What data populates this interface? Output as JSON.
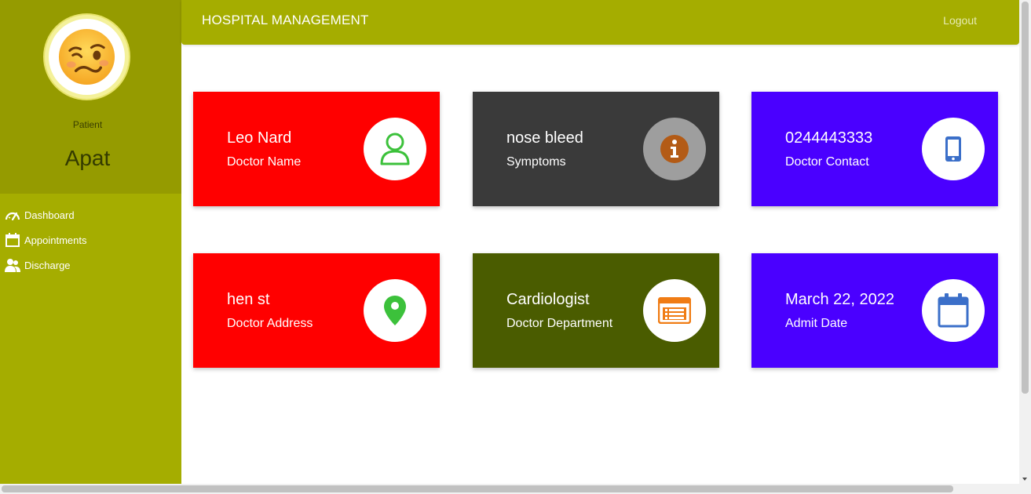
{
  "header": {
    "brand": "HOSPITAL MANAGEMENT",
    "logout_label": "Logout"
  },
  "sidebar": {
    "role": "Patient",
    "username": "Apat",
    "items": [
      {
        "label": "Dashboard",
        "icon": "dashboard-gauge-icon"
      },
      {
        "label": "Appointments",
        "icon": "calendar-icon"
      },
      {
        "label": "Discharge",
        "icon": "users-icon"
      }
    ]
  },
  "cards": [
    {
      "value": "Leo Nard",
      "label": "Doctor Name",
      "icon": "user-icon",
      "bg": "#ff0000",
      "icon_color": "#3cc13b"
    },
    {
      "value": "nose bleed",
      "label": "Symptoms",
      "icon": "info-icon",
      "bg": "#3a3a3a",
      "icon_color": "#b35b16"
    },
    {
      "value": "0244443333",
      "label": "Doctor Contact",
      "icon": "mobile-phone-icon",
      "bg": "#4a00ff",
      "icon_color": "#3b6fc9"
    },
    {
      "value": "hen st",
      "label": "Doctor Address",
      "icon": "map-pin-icon",
      "bg": "#ff0000",
      "icon_color": "#3cc13b"
    },
    {
      "value": "Cardiologist",
      "label": "Doctor Department",
      "icon": "list-icon",
      "bg": "#4a5c00",
      "icon_color": "#f07c14"
    },
    {
      "value": "March 22, 2022",
      "label": "Admit Date",
      "icon": "calendar-icon",
      "bg": "#4a00ff",
      "icon_color": "#3b6fc9"
    }
  ]
}
